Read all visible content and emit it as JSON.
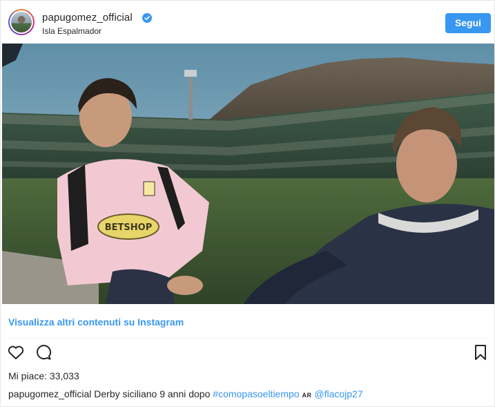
{
  "post": {
    "username": "papugomez_official",
    "location": "Isla Espalmador",
    "follow_label": "Segui",
    "view_more": "Visualizza altri contenuti su Instagram",
    "likes_label": "Mi piace:",
    "likes_count": "33,033",
    "caption": {
      "user": "papugomez_official",
      "text": "Derby siciliano 9 anni dopo",
      "hashtag": "#comopasoeltiempo",
      "flag": "AR",
      "mention": "@flacojp27"
    },
    "photo_jersey_text": "BETSHOP"
  },
  "colors": {
    "accent": "#3897f0",
    "text": "#262626",
    "border": "#e6e6e6"
  },
  "icons": [
    "verified-badge-icon",
    "heart-icon",
    "comment-icon",
    "bookmark-icon"
  ]
}
